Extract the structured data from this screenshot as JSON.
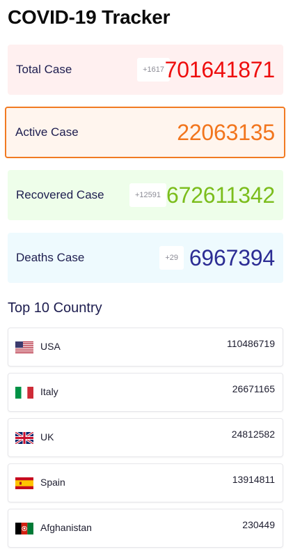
{
  "app": {
    "title": "COVID-19 Tracker"
  },
  "stats": {
    "total": {
      "label": "Total Case",
      "delta": "+1617",
      "value": "701641871",
      "color": "#ee0d0d",
      "bg": "#fff0f0"
    },
    "active": {
      "label": "Active Case",
      "value": "22063135",
      "color": "#f2751d",
      "bg": "#fff5ee",
      "border": "#f17a22"
    },
    "recovered": {
      "label": "Recovered Case",
      "delta": "+12591",
      "value": "672611342",
      "color": "#7bbd1c",
      "bg": "#eefeea"
    },
    "deaths": {
      "label": "Deaths Case",
      "delta": "+29",
      "value": "6967394",
      "color": "#2c2d94",
      "bg": "#eefafe"
    }
  },
  "top_countries": {
    "title": "Top 10 Country",
    "items": [
      {
        "name": "USA",
        "count": "110486719",
        "flag": "us-flag-icon"
      },
      {
        "name": "Italy",
        "count": "26671165",
        "flag": "italy-flag-icon"
      },
      {
        "name": "UK",
        "count": "24812582",
        "flag": "uk-flag-icon"
      },
      {
        "name": "Spain",
        "count": "13914811",
        "flag": "spain-flag-icon"
      },
      {
        "name": "Afghanistan",
        "count": "230449",
        "flag": "afghanistan-flag-icon"
      }
    ]
  }
}
